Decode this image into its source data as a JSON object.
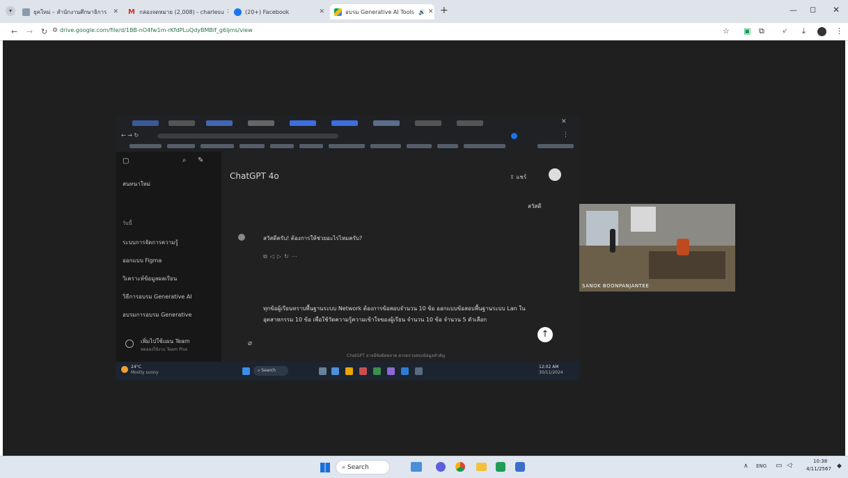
{
  "browser": {
    "tabs": [
      {
        "label": "ยุคใหม่ – สำนักงานศึกษาธิการ",
        "icon": "site-favicon",
        "active": false
      },
      {
        "label": "กล่องจดหมาย (2,008) - charlesu",
        "icon": "gmail-icon",
        "active": false
      },
      {
        "label": "(20+) Facebook",
        "icon": "facebook-icon",
        "active": false
      },
      {
        "label": "อบรม Generative AI Tools",
        "icon": "google-drive-icon",
        "active": true
      }
    ],
    "url": "drive.google.com/file/d/1BB-nO4fw1m-rKfdPLuQdyBMBlf_g6ljms/view",
    "new_tab_label": "+"
  },
  "inner": {
    "chatgpt_title": "ChatGPT 4o",
    "share_label": "แชร์",
    "sidebar_new": "สนทนาใหม่",
    "sidebar_today": "วันนี้",
    "sidebar_items": [
      "ระบบการจัดการความรู้",
      "ออกแบบ Figma",
      "วิเคราะห์ข้อมูลผลเรียน",
      "วิธีการอบรม Generative AI",
      "อบรมการอบรม Generative"
    ],
    "upgrade_title": "เพิ่มไปใช้แผน Team",
    "upgrade_sub": "ทดลองใช้งาน Team Plus",
    "user_msg_1": "สวัสดี",
    "assistant_msg": "สวัสดีครับ! ต้องการให้ช่วยอะไรไหมครับ?",
    "user_msg_2": "ทุกข้อผู้เรียนทราบพื้นฐานระบบ Network ต้องการข้อสอบจำนวน 10 ข้อ ออกแบบข้อสอบพื้นฐานระบบ Lan ในอุตสาหกรรม 10 ข้อ เพื่อใช้วัดความรู้ความเข้าใจของผู้เรียน จำนวน 10 ข้อ จำนวน 5 ตัวเลือก",
    "footer_note": "ChatGPT อาจมีข้อผิดพลาด ควรตรวจสอบข้อมูลสำคัญ",
    "taskbar_time": "12:02 AM",
    "taskbar_date": "30/11/2024",
    "weather": "24°C",
    "weather_sub": "Mostly sunny",
    "search_label": "Search"
  },
  "camera_label": "SANOK BOONPANJANTEE",
  "taskbar": {
    "search_label": "Search",
    "lang": "ENG",
    "time": "10:38",
    "date": "4/11/2567"
  },
  "colors": {
    "viewer_bg": "#1f1f1f",
    "accent": "#1a73e8",
    "taskbar_bg": "#dfe6ef"
  }
}
